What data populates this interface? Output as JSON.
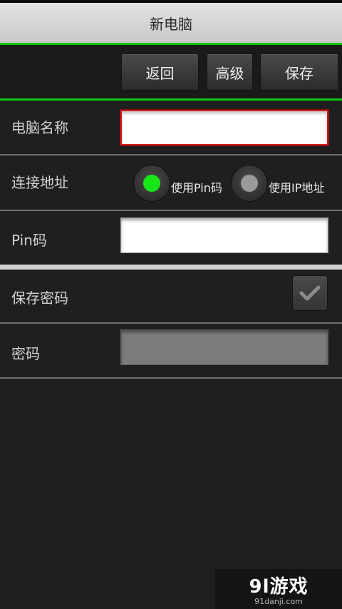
{
  "title": "新电脑",
  "toolbar": {
    "back_label": "返回",
    "advanced_label": "高级",
    "save_label": "保存"
  },
  "form": {
    "pc_name": {
      "label": "电脑名称",
      "value": "",
      "placeholder": ""
    },
    "connect": {
      "label": "连接地址",
      "options": [
        {
          "label": "使用Pin码",
          "selected": true
        },
        {
          "label": "使用IP地址",
          "selected": false
        }
      ]
    },
    "pin": {
      "label": "Pin码",
      "value": ""
    },
    "save_password": {
      "label": "保存密码",
      "checked": false
    },
    "password": {
      "label": "密码",
      "value": ""
    }
  },
  "watermark": {
    "main": "9l游戏",
    "sub": "91danji.com"
  },
  "colors": {
    "accent_green": "#11c611",
    "focus_red": "#d21a1a",
    "radio_on": "#19e619",
    "radio_off": "#9a9a9a"
  }
}
